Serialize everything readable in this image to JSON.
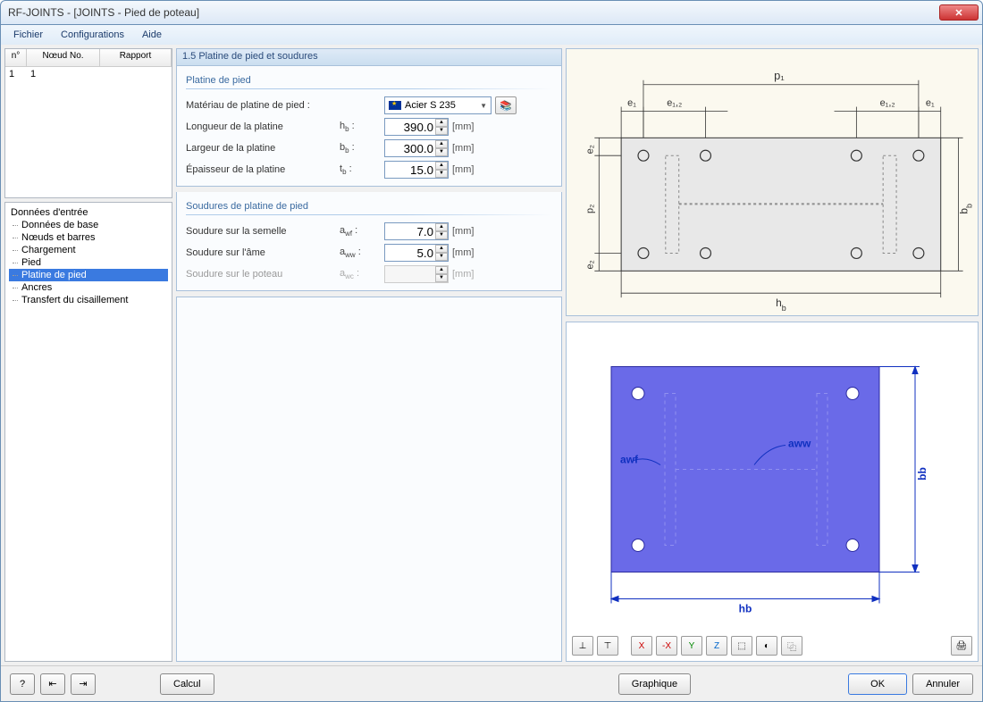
{
  "titlebar": {
    "text": "RF-JOINTS - [JOINTS - Pied de poteau]"
  },
  "menubar": {
    "file": "Fichier",
    "config": "Configurations",
    "help": "Aide"
  },
  "grid": {
    "headers": {
      "n": "n°",
      "node": "Nœud No.",
      "report": "Rapport"
    },
    "row1": {
      "n": "1",
      "node": "1"
    }
  },
  "tree": {
    "root": "Données d'entrée",
    "items": {
      "base": "Données de base",
      "nodes": "Nœuds et barres",
      "loading": "Chargement",
      "foot": "Pied",
      "baseplate": "Platine de pied",
      "anchors": "Ancres",
      "shear": "Transfert du cisaillement"
    }
  },
  "panel": {
    "header": "1.5 Platine de pied et soudures",
    "group1": {
      "title": "Platine de pied",
      "material_label": "Matériau de platine de pied :",
      "material_value": "Acier S 235",
      "length_label": "Longueur de la platine",
      "length_sym": "hb :",
      "length_val": "390.0",
      "width_label": "Largeur de la platine",
      "width_sym": "bb :",
      "width_val": "300.0",
      "thick_label": "Épaisseur de la platine",
      "thick_sym": "tb :",
      "thick_val": "15.0",
      "unit": "[mm]"
    },
    "group2": {
      "title": "Soudures de platine de pied",
      "flange_label": "Soudure sur la semelle",
      "flange_sym": "awf :",
      "flange_val": "7.0",
      "web_label": "Soudure sur l'âme",
      "web_sym": "aww :",
      "web_val": "5.0",
      "col_label": "Soudure sur le poteau",
      "col_sym": "awc :",
      "unit": "[mm]"
    }
  },
  "diagram_top": {
    "p1": "p₁",
    "e1": "e₁",
    "e12": "e₁,₂",
    "e2": "e₂",
    "p2": "p₂",
    "bb": "bb",
    "hb": "hb"
  },
  "diagram_bottom": {
    "awf": "awf",
    "aww": "aww",
    "hb": "hb",
    "bb": "bb"
  },
  "footer": {
    "calc": "Calcul",
    "graphic": "Graphique",
    "ok": "OK",
    "cancel": "Annuler"
  }
}
